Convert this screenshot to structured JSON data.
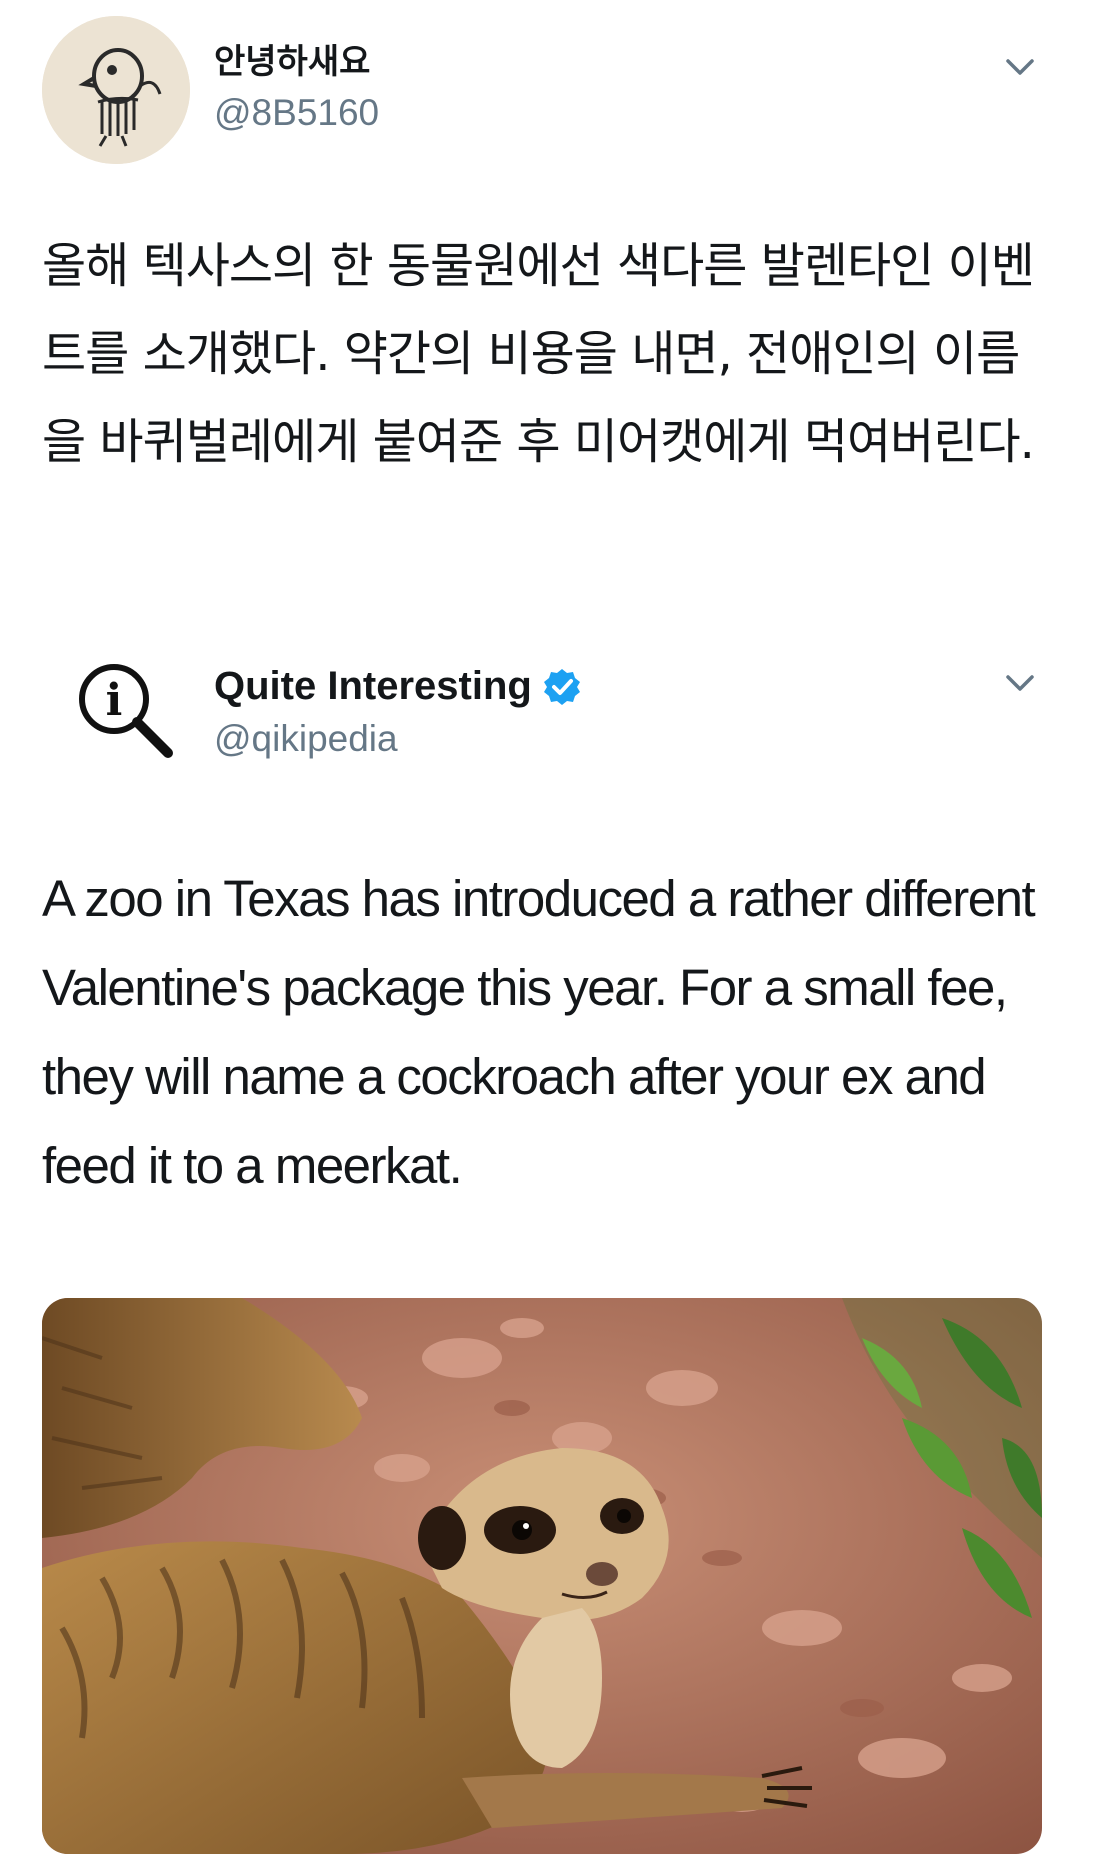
{
  "outer_tweet": {
    "display_name": "안녕하새요",
    "handle": "@8B5160",
    "text": "올해 텍사스의 한 동물원에선 색다른 발렌타인 이벤트를 소개했다. 약간의 비용을 내면, 전애인의 이름을 바퀴벌레에게 붙여준 후 미어캣에게 먹여버린다.",
    "avatar_icon": "bird-doodle-icon",
    "menu_icon": "chevron-down-icon"
  },
  "quoted_tweet": {
    "display_name": "Quite Interesting",
    "handle": "@qikipedia",
    "verified_icon": "verified-badge-icon",
    "avatar_icon": "magnifier-info-icon",
    "menu_icon": "chevron-down-icon",
    "text": "A zoo in Texas has introduced a rather different Valentine's package this year. For a small fee, they will name a cockroach after your ex and feed it to a meerkat.",
    "media_icon": "meerkat-photo"
  },
  "colors": {
    "text": "#14171a",
    "secondary_text": "#657786",
    "verified_blue": "#1da1f2",
    "background": "#ffffff"
  }
}
